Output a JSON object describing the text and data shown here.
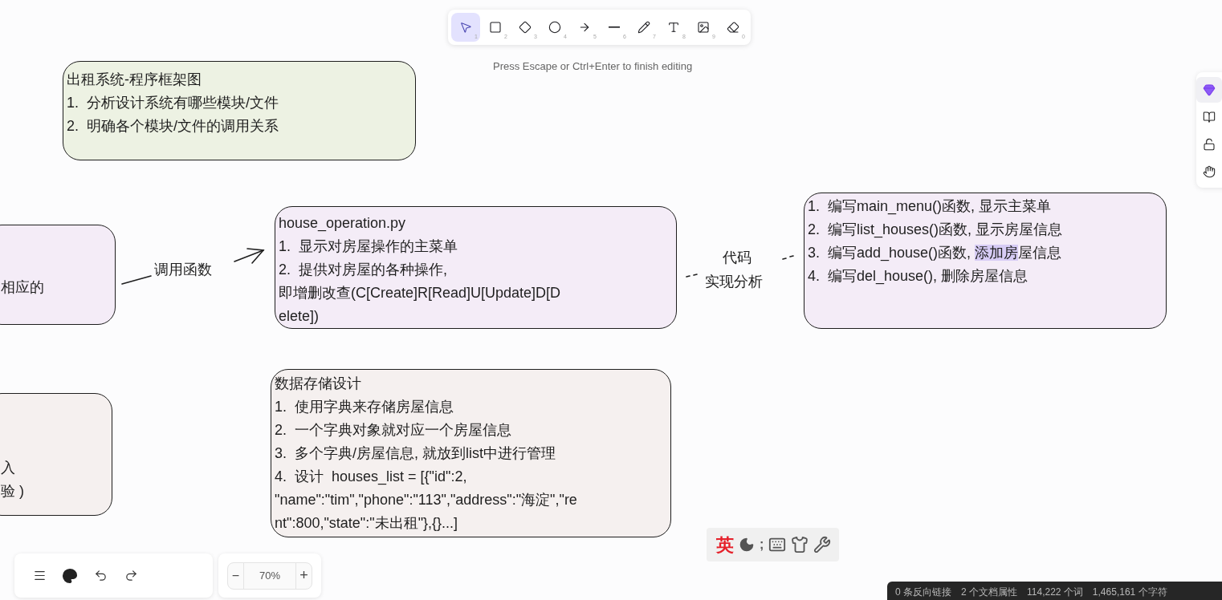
{
  "toolbar": {
    "tools": [
      {
        "kind": "select",
        "key": "1",
        "selected": true
      },
      {
        "kind": "rectangle",
        "key": "2",
        "selected": false
      },
      {
        "kind": "diamond",
        "key": "3",
        "selected": false
      },
      {
        "kind": "ellipse",
        "key": "4",
        "selected": false
      },
      {
        "kind": "arrow",
        "key": "5",
        "selected": false
      },
      {
        "kind": "line",
        "key": "6",
        "selected": false
      },
      {
        "kind": "draw",
        "key": "7",
        "selected": false
      },
      {
        "kind": "text",
        "key": "8",
        "selected": false
      },
      {
        "kind": "image",
        "key": "9",
        "selected": false
      },
      {
        "kind": "eraser",
        "key": "0",
        "selected": false
      }
    ],
    "hint": "Press Escape or Ctrl+Enter to finish editing"
  },
  "canvas": {
    "cards": [
      {
        "kind": "green",
        "lines": [
          [
            {
              "text": "出租系统-程序框架图",
              "highlighted": false
            }
          ],
          [
            {
              "text": "1.  分析设计系统有哪些模块/文件",
              "highlighted": false
            }
          ],
          [
            {
              "text": "2.  明确各个模块/文件的调用关系",
              "highlighted": false
            }
          ]
        ]
      },
      {
        "kind": "purple-cut",
        "lines": [
          [
            {
              "text": "相应的",
              "highlighted": false
            }
          ]
        ]
      },
      {
        "kind": "purple",
        "lines": [
          [
            {
              "text": "house_operation.py",
              "highlighted": false
            }
          ],
          [
            {
              "text": "1.  显示对房屋操作的主菜单",
              "highlighted": false
            }
          ],
          [
            {
              "text": "2.  提供对房屋的各种操作,",
              "highlighted": false
            }
          ],
          [
            {
              "text": "即增删改查(C[Create]R[Read]U[Update]D[D",
              "highlighted": false
            }
          ],
          [
            {
              "text": "elete])",
              "highlighted": false
            }
          ]
        ]
      },
      {
        "kind": "purple-right",
        "lines": [
          [
            {
              "text": "1.  编写main_menu()函数, 显示主菜单",
              "highlighted": false
            }
          ],
          [
            {
              "text": "2.  编写list_houses()函数, 显示房屋信息",
              "highlighted": false
            }
          ],
          [
            {
              "text": "3.  编写add_house()函数, ",
              "highlighted": false
            },
            {
              "text": "添加房",
              "highlighted": true
            },
            {
              "text": "屋信息",
              "highlighted": false
            }
          ],
          [
            {
              "text": "4.  编写del_house(), 删除房屋信息",
              "highlighted": false
            }
          ]
        ]
      },
      {
        "kind": "grey-cut",
        "lines": [
          [
            {
              "text": "入",
              "highlighted": false
            }
          ],
          [
            {
              "text": "验 )",
              "highlighted": false
            }
          ]
        ]
      },
      {
        "kind": "grey",
        "lines": [
          [
            {
              "text": "数据存储设计",
              "highlighted": false
            }
          ],
          [
            {
              "text": "1.  使用字典来存储房屋信息",
              "highlighted": false
            }
          ],
          [
            {
              "text": "2.  一个字典对象就对应一个房屋信息",
              "highlighted": false
            }
          ],
          [
            {
              "text": "3.  多个字典/房屋信息, 就放到list中进行管理",
              "highlighted": false
            }
          ],
          [
            {
              "text": "4.  设计  houses_list = [{\"id\":2,",
              "highlighted": false
            }
          ],
          [
            {
              "text": "\"name\":\"tim\",\"phone\":\"113\",\"address\":\"海淀\",\"re",
              "highlighted": false
            }
          ],
          [
            {
              "text": "nt\":800,\"state\":\"未出租\"},{}...]",
              "highlighted": false
            }
          ]
        ]
      }
    ],
    "labels": [
      {
        "kind": "call",
        "text": "调用函数"
      },
      {
        "kind": "code",
        "text": "代码"
      },
      {
        "kind": "analysis",
        "text": "实现分析"
      }
    ]
  },
  "side_panel": {
    "tools": [
      {
        "kind": "gem"
      },
      {
        "kind": "book"
      },
      {
        "kind": "lock"
      },
      {
        "kind": "hand"
      }
    ]
  },
  "bottom_bar": {
    "actions": [
      {
        "kind": "menu"
      },
      {
        "kind": "palette"
      },
      {
        "kind": "undo"
      },
      {
        "kind": "redo"
      }
    ],
    "zoom_out": "−",
    "zoom": "70%",
    "zoom_in": "+"
  },
  "ime_bar": {
    "mode": "英",
    "punct": ";",
    "tools": [
      {
        "kind": "moon"
      },
      {
        "kind": "keyboard"
      },
      {
        "kind": "shirt"
      },
      {
        "kind": "wrench"
      }
    ]
  },
  "status_bar": [
    "0 条反向链接",
    "2 个文档属性",
    "114,222 个词",
    "1,465,161 个字符"
  ]
}
